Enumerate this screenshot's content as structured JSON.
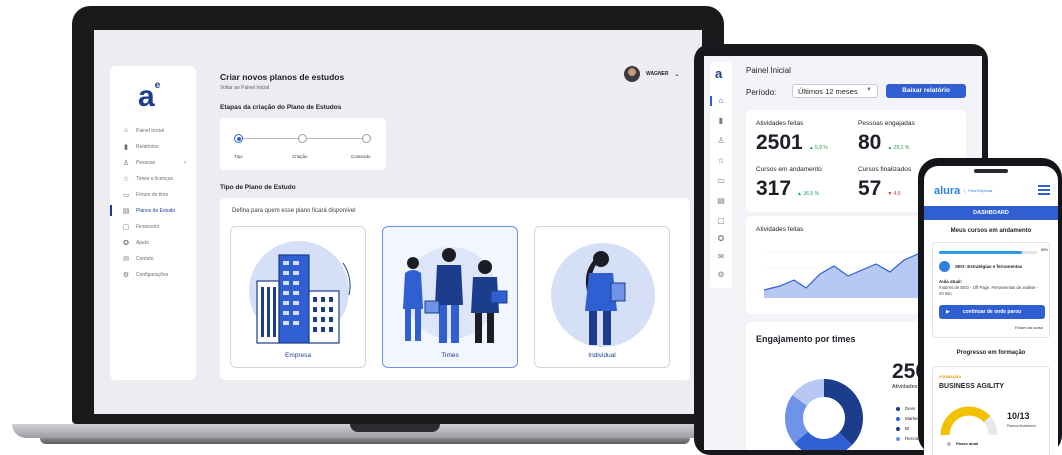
{
  "laptop": {
    "logo": "a",
    "logo_sup": "e",
    "title": "Criar novos planos de estudos",
    "back": "Voltar ao Painel Inicial",
    "user": "WAGNER",
    "nav": [
      {
        "label": "Painel Inicial",
        "icon": "home-icon",
        "glyph": "⌂"
      },
      {
        "label": "Relatórios",
        "icon": "bar-chart-icon",
        "glyph": "▮"
      },
      {
        "label": "Pessoas",
        "icon": "people-icon",
        "glyph": "♙"
      },
      {
        "label": "Times e licenças",
        "icon": "star-icon",
        "glyph": "☆"
      },
      {
        "label": "Fórum do time",
        "icon": "forum-icon",
        "glyph": "▭"
      },
      {
        "label": "Planos de Estudo",
        "icon": "document-icon",
        "glyph": "▤"
      },
      {
        "label": "Financeiro",
        "icon": "finance-icon",
        "glyph": "▢"
      },
      {
        "label": "Ajuda",
        "icon": "help-icon",
        "glyph": "✪"
      },
      {
        "label": "Contato",
        "icon": "mail-icon",
        "glyph": "✉"
      },
      {
        "label": "Configurações",
        "icon": "gear-icon",
        "glyph": "⚙"
      }
    ],
    "steps_title": "Etapas da criação do Plano de Estudos",
    "steps": [
      "Tipo",
      "Criação",
      "Conteúdo"
    ],
    "type_title": "Tipo de Plano de Estudo",
    "type_hint": "Defina para quem esse plano ficará disponível",
    "cards": [
      "Empresa",
      "Times",
      "Individual"
    ],
    "colors": {
      "primary": "#1c3c8c",
      "accent": "#2f5fd0",
      "selected_border": "#6f93e6"
    }
  },
  "tablet": {
    "logo": "a",
    "title": "Painel Inicial",
    "period_label": "Período:",
    "period_value": "Últimos 12 meses",
    "report_button": "Baixar relatório",
    "stats": [
      {
        "label": "Atividades feitas",
        "value": "2501",
        "delta": "▲ 5,9 %",
        "trend": "up"
      },
      {
        "label": "Pessoas engajadas",
        "value": "80",
        "delta": "▲ 25,1 %",
        "trend": "up"
      },
      {
        "label": "Cursos em andamento",
        "value": "317",
        "delta": "▲ 36,5 %",
        "trend": "up"
      },
      {
        "label": "Cursos finalizados",
        "value": "57",
        "delta": "▼ 4,6",
        "trend": "down"
      }
    ],
    "chart_label": "Atividades feitas",
    "engagement_title": "Engajamento por times",
    "engagement_value": "250",
    "engagement_sub": "Atividades",
    "legend": [
      {
        "label": "Devs",
        "color": "#1c3c8c"
      },
      {
        "label": "Marketing",
        "color": "#2f5fd0"
      },
      {
        "label": "BI",
        "color": "#1c3c8c"
      },
      {
        "label": "Recrutamento",
        "color": "#6f93e6"
      }
    ]
  },
  "phone": {
    "logo": "alura",
    "logo_sub": "Para Empresas",
    "dashboard": "DASHBOARD",
    "my_courses": "Meus cursos em andamento",
    "course_progress": 0.85,
    "course_pct": "85%",
    "course_name": "SEO: Estratégias e ferramentas",
    "aula_label": "Aula atual:",
    "aula_text": "Fatores de SEO - Off Page: Ferramentas de análise - 20 min",
    "continue": "continuar de onde parou",
    "forum": "Fórum do curso",
    "progress_title": "Progresso em formação",
    "formation_tag": "FORMAÇÃO",
    "formation_name": "BUSINESS AGILITY",
    "ratio": "10/13",
    "ratio_sub": "Passos finalizados",
    "next_step": "Passo atual",
    "colors": {
      "brand": "#2f7fe0",
      "button": "#2f5fd0",
      "gauge": "#f2c200"
    }
  }
}
